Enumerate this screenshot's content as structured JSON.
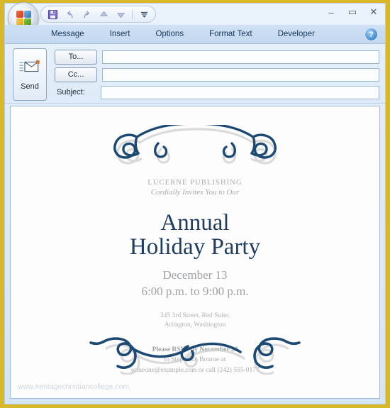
{
  "window": {
    "quick_access": [
      {
        "name": "save-button",
        "icon": "floppy-disk-icon",
        "label": "Save"
      },
      {
        "name": "undo-button",
        "icon": "undo-arrow-icon",
        "label": "Undo"
      },
      {
        "name": "redo-button",
        "icon": "redo-arrow-icon",
        "label": "Redo"
      },
      {
        "name": "previous-item-button",
        "icon": "up-arrow-icon",
        "label": "Previous Item"
      },
      {
        "name": "next-item-button",
        "icon": "down-arrow-icon",
        "label": "Next Item"
      },
      {
        "name": "customize-qat-button",
        "icon": "chevron-down-icon",
        "label": "Customize Quick Access Toolbar"
      }
    ],
    "controls": {
      "minimize": "–",
      "maximize": "▭",
      "close": "✕",
      "help": "?"
    },
    "office_button_label": "Office Button"
  },
  "ribbon": {
    "tabs": [
      {
        "label": "Message",
        "active": true
      },
      {
        "label": "Insert",
        "active": false
      },
      {
        "label": "Options",
        "active": false
      },
      {
        "label": "Format Text",
        "active": false
      },
      {
        "label": "Developer",
        "active": false
      }
    ]
  },
  "compose": {
    "send_label": "Send",
    "to_label": "To...",
    "cc_label": "Cc...",
    "subject_label": "Subject:",
    "to_value": "",
    "cc_value": "",
    "subject_value": "",
    "to_placeholder": "",
    "cc_placeholder": "",
    "subject_placeholder": ""
  },
  "invitation": {
    "brand": "LUCERNE PUBLISHING",
    "subtitle": "Cordially Invites You to Our",
    "title_line1": "Annual",
    "title_line2": "Holiday Party",
    "date": "December 13",
    "time": "6:00 p.m. to 9:00 p.m.",
    "address_line1": "345 3rd Street, Red Suite,",
    "address_line2": "Arlington, Washington",
    "rsvp_line1": "Please RSVP by November 23",
    "rsvp_line2": "to  Stephanie Bourne at",
    "rsvp_line3": "someone@example.com or call (242) 555-0177",
    "watermark": "www.heritagechristiancollege.com"
  },
  "colors": {
    "frame_gold": "#d9b827",
    "title_navy": "#1f3c61",
    "muted_gray": "#a8aaad",
    "flourish_blue": "#1d4a74",
    "ribbon_blue": "#c4d8f0"
  }
}
